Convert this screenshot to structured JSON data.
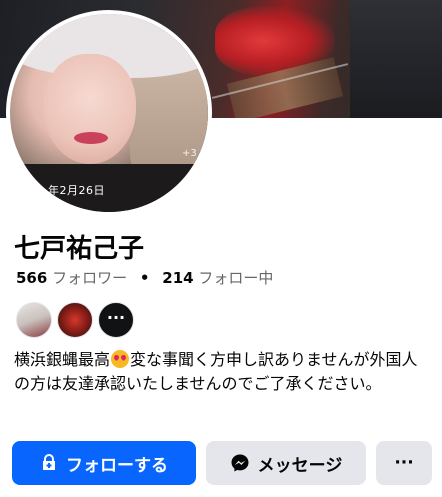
{
  "profile": {
    "photo_date": "年2月26日",
    "photo_more": "+3",
    "name": "七戸祐己子",
    "followers_count": "566",
    "followers_label": "フォロワー",
    "separator": "•",
    "following_count": "214",
    "following_label": "フォロー中",
    "friends_more": "···"
  },
  "bio": {
    "before_emoji": "横浜銀蝿最高",
    "after_emoji": "変な事聞く方申し訳ありませんが外国人の方は友達承認いたしませんのでご了承ください。"
  },
  "actions": {
    "follow_label": "フォローする",
    "message_label": "メッセージ",
    "more_label": "···"
  },
  "colors": {
    "primary": "#0866ff",
    "secondary_button": "#e4e6eb",
    "muted_text": "#65676b"
  }
}
